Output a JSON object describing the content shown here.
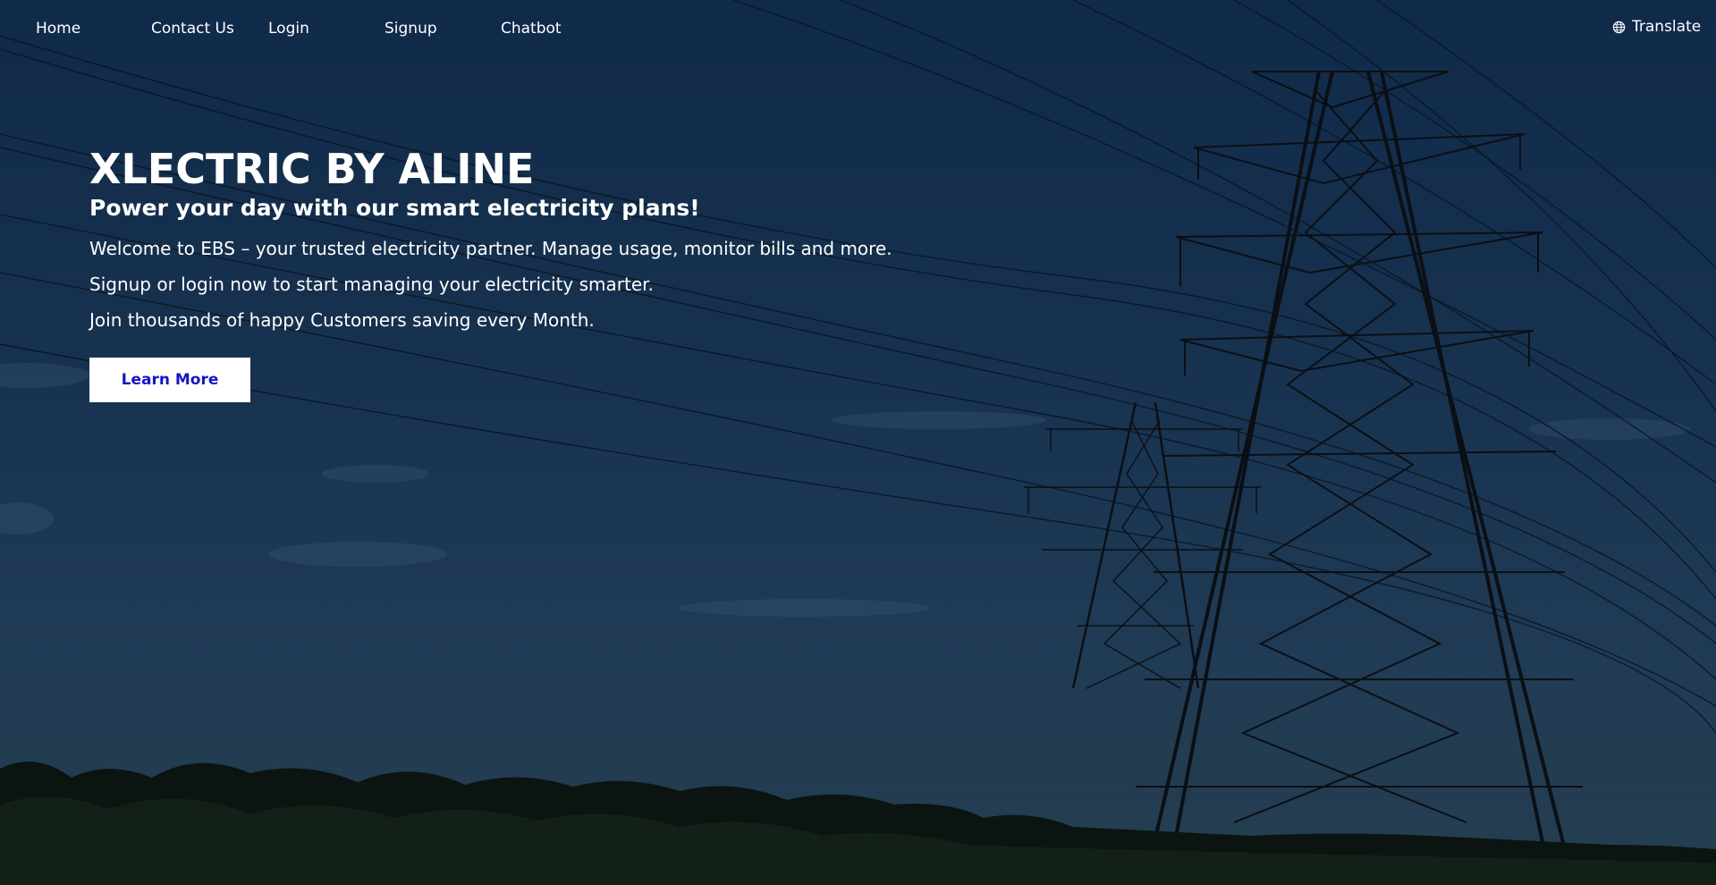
{
  "nav": {
    "items": [
      {
        "label": "Home"
      },
      {
        "label": "Contact Us"
      },
      {
        "label": "Login"
      },
      {
        "label": "Signup"
      },
      {
        "label": "Chatbot"
      }
    ],
    "translate_label": "Translate"
  },
  "hero": {
    "title": "XLECTRIC BY ALINE",
    "subtitle": "Power your day with our smart electricity plans!",
    "lines": [
      "Welcome to EBS – your trusted electricity partner. Manage usage, monitor bills and more.",
      "Signup or login now to start managing your electricity smarter.",
      "Join thousands of happy Customers saving every Month."
    ],
    "button_label": "Learn More"
  },
  "colors": {
    "sky_top": "#102a49",
    "sky_bottom": "#1d3447",
    "button_text": "#1414c8",
    "text": "#ffffff"
  },
  "icons": {
    "translate": "globe-icon"
  }
}
